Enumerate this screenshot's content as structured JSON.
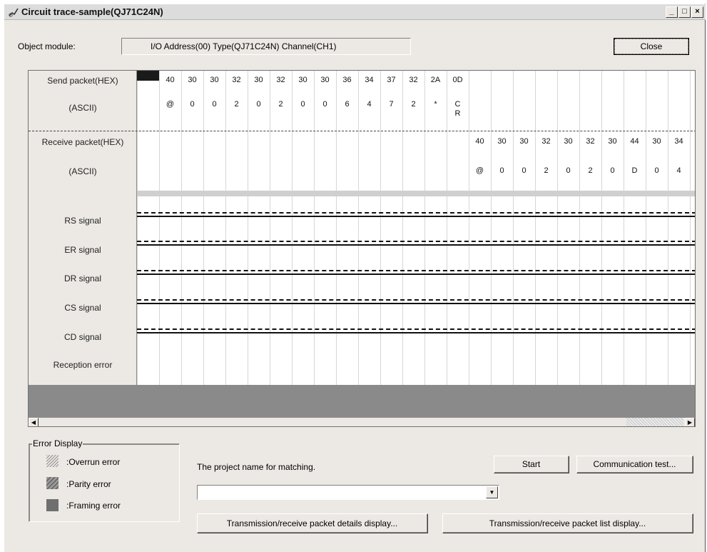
{
  "window": {
    "title": "Circuit trace-sample(QJ71C24N)",
    "controls": [
      "_",
      "□",
      "×"
    ]
  },
  "header": {
    "object_module_label": "Object module:",
    "object_module_value": "I/O Address(00) Type(QJ71C24N) Channel(CH1)",
    "close_label": "Close"
  },
  "trace": {
    "row_labels": {
      "send_hex": "Send packet(HEX)",
      "send_ascii": "(ASCII)",
      "recv_hex": "Receive packet(HEX)",
      "recv_ascii": "(ASCII)",
      "rs": "RS signal",
      "er": "ER signal",
      "dr": "DR signal",
      "cs": "CS signal",
      "cd": "CD signal",
      "rx_error": "Reception error"
    },
    "send_hex": [
      "40",
      "30",
      "30",
      "32",
      "30",
      "32",
      "30",
      "30",
      "36",
      "34",
      "37",
      "32",
      "2A",
      "0D"
    ],
    "send_ascii": [
      "@",
      "0",
      "0",
      "2",
      "0",
      "2",
      "0",
      "0",
      "6",
      "4",
      "7",
      "2",
      "*",
      "C\nR"
    ],
    "recv_hex": [
      "40",
      "30",
      "30",
      "32",
      "30",
      "32",
      "30",
      "44",
      "30",
      "34"
    ],
    "recv_ascii": [
      "@",
      "0",
      "0",
      "2",
      "0",
      "2",
      "0",
      "D",
      "0",
      "4"
    ]
  },
  "error_display": {
    "legend": "Error Display",
    "items": [
      {
        "label": ":Overrun error",
        "icon": "overrun-swatch"
      },
      {
        "label": ":Parity error",
        "icon": "parity-swatch"
      },
      {
        "label": ":Framing error",
        "icon": "framing-swatch"
      }
    ]
  },
  "actions": {
    "project_label": "The project name for matching.",
    "project_value": "",
    "start": "Start",
    "comm_test": "Communication test...",
    "details": "Transmission/receive packet details display...",
    "list": "Transmission/receive packet list display..."
  }
}
